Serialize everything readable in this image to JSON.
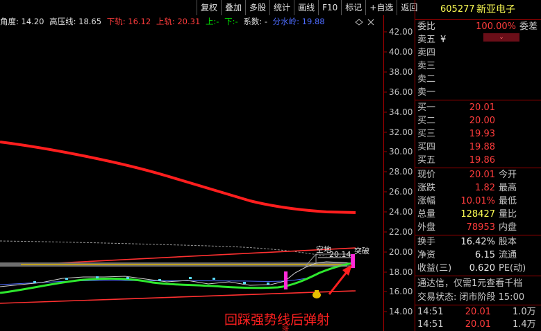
{
  "toolbar": {
    "buttons": [
      "复权",
      "叠加",
      "多股",
      "统计",
      "画线",
      "F10",
      "标记",
      "+自选",
      "返回"
    ]
  },
  "indicator": {
    "angle_label": "角度: 14.20",
    "high_line_label": "高压线: 18.65",
    "lower_rail_label": "下轨: 16.12",
    "upper_rail_label": "上轨: 20.31",
    "up_label": "上:-",
    "down_label": "下:-",
    "coef_label": "系数: -",
    "water_label": "分水岭: 19.88"
  },
  "axis": {
    "ticks": [
      "42.00",
      "40.00",
      "38.00",
      "36.00",
      "34.00",
      "32.00",
      "30.00",
      "28.00",
      "26.00",
      "24.00",
      "22.00",
      "20.00",
      "18.00",
      "16.00",
      "14.00"
    ]
  },
  "annotations": {
    "breakout": "突破",
    "dummy": "空地",
    "price_tag": "20.14",
    "caption": "回踩强势线后弹射",
    "bottom_mark": "涨"
  },
  "stock": {
    "code": "605277",
    "name": "新亚电子"
  },
  "order_book": {
    "ratio_label": "委比",
    "ratio_value": "100.00%",
    "diff_label": "委差",
    "sell_levels": [
      {
        "label": "卖五",
        "price": "¥"
      },
      {
        "label": "卖四",
        "price": ""
      },
      {
        "label": "卖三",
        "price": ""
      },
      {
        "label": "卖二",
        "price": ""
      },
      {
        "label": "卖一",
        "price": ""
      }
    ],
    "buy_levels": [
      {
        "label": "买一",
        "price": "20.01"
      },
      {
        "label": "买二",
        "price": "20.00"
      },
      {
        "label": "买三",
        "price": "19.93"
      },
      {
        "label": "买四",
        "price": "19.88"
      },
      {
        "label": "买五",
        "price": "19.86"
      }
    ]
  },
  "quote": {
    "rows": [
      {
        "l1": "现价",
        "v": "20.01",
        "l2": "今开",
        "color": "red"
      },
      {
        "l1": "涨跌",
        "v": "1.82",
        "l2": "最高",
        "color": "red"
      },
      {
        "l1": "涨幅",
        "v": "10.01%",
        "l2": "最低",
        "color": "red"
      },
      {
        "l1": "总量",
        "v": "128427",
        "l2": "量比",
        "color": "yellow"
      },
      {
        "l1": "外盘",
        "v": "78953",
        "l2": "内盘",
        "color": "red"
      }
    ],
    "rows2": [
      {
        "l1": "换手",
        "v": "16.42%",
        "l2": "股本",
        "color": "white"
      },
      {
        "l1": "净资",
        "v": "6.15",
        "l2": "流通",
        "color": "white"
      },
      {
        "l1": "收益(三)",
        "v": "0.620",
        "l2": "PE(动)",
        "color": "white"
      }
    ]
  },
  "promo": "通达信，仅需1元查看千档",
  "trade_state": "交易状态: 闭市阶段 15:00",
  "ticks": [
    {
      "time": "14:51",
      "price": "20.01",
      "vol": "1.0万"
    },
    {
      "time": "14:51",
      "price": "20.01",
      "vol": "1.4万"
    }
  ],
  "colors": {
    "up": "#ff3c3c",
    "down": "#00e000",
    "neutral": "#ffff54",
    "frame": "#a00000"
  }
}
